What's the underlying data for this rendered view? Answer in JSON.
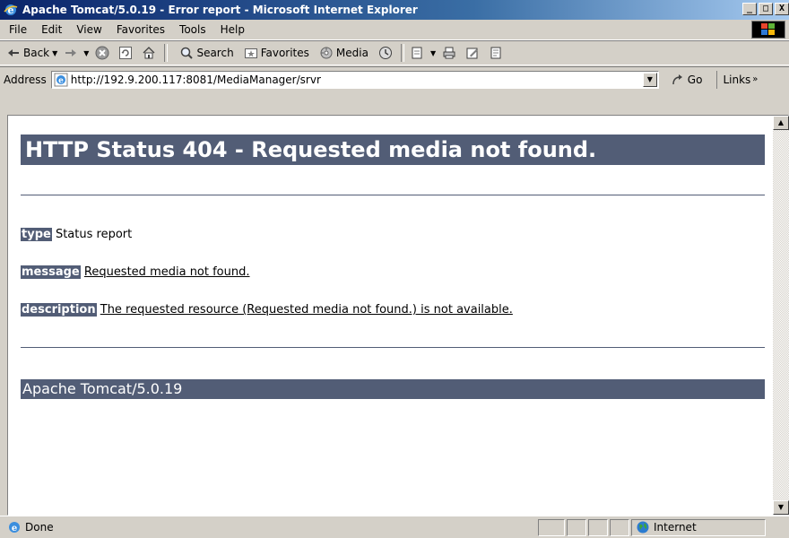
{
  "window": {
    "title": "Apache Tomcat/5.0.19 - Error report - Microsoft Internet Explorer",
    "controls": {
      "minimize": "_",
      "maximize": "□",
      "close": "X"
    }
  },
  "menu": {
    "items": [
      "File",
      "Edit",
      "View",
      "Favorites",
      "Tools",
      "Help"
    ]
  },
  "toolbar": {
    "back": "Back",
    "search": "Search",
    "favorites": "Favorites",
    "media": "Media"
  },
  "address": {
    "label": "Address",
    "url": "http://192.9.200.117:8081/MediaManager/srvr",
    "go": "Go",
    "links": "Links"
  },
  "page": {
    "heading": "HTTP Status 404 - Requested media not found.",
    "type_label": "type",
    "type_value": "Status report",
    "message_label": "message",
    "message_value": "Requested media not found.",
    "description_label": "description",
    "description_value": "The requested resource (Requested media not found.) is not available.",
    "footer": "Apache Tomcat/5.0.19"
  },
  "status": {
    "text": "Done",
    "zone": "Internet"
  },
  "colors": {
    "tomcat_header": "#525d76",
    "titlebar_start": "#0a246a"
  }
}
